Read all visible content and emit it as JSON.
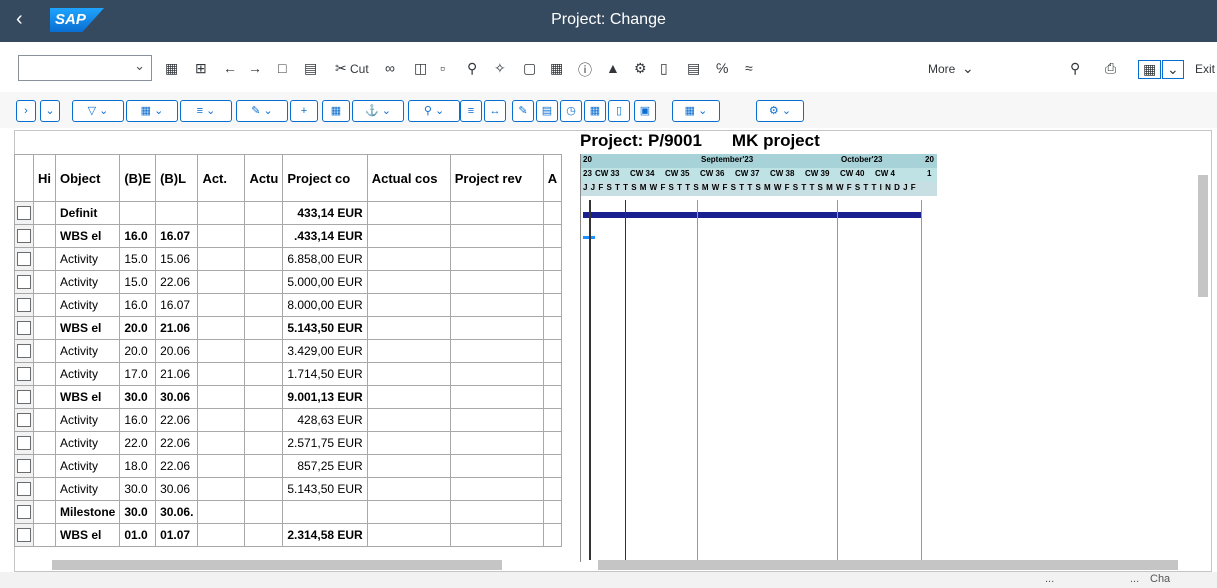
{
  "window": {
    "title": "Project: Change",
    "logo_text": "SAP"
  },
  "toolbar": {
    "icons": [
      "tree-icon",
      "grid-icon",
      "back-arrow-icon",
      "forward-arrow-icon",
      "copy-icon",
      "paste-icon",
      "scissors-icon",
      "link-icon",
      "save-icon",
      "delete-icon",
      "zoom-icon",
      "wand-icon",
      "frame-icon",
      "calculator-icon",
      "info-icon",
      "hat-icon",
      "network-icon",
      "chart-icon",
      "doc-icon",
      "percent-icon",
      "linechart-icon"
    ],
    "cut_label": "Cut",
    "more_label": "More",
    "exit_label": "Exit"
  },
  "gantt": {
    "project_label": "Project: P/9001",
    "project_name": "MK project",
    "months": [
      "20",
      "September'23",
      "October'23",
      "20"
    ],
    "weeks": [
      "23",
      "CW 33",
      "CW 34",
      "CW 35",
      "CW 36",
      "CW 37",
      "CW 38",
      "CW 39",
      "CW 40",
      "CW 4",
      "1"
    ],
    "days_text": "J J F S T T S M W F S T T S M W F S T T S M W F S T T S M W F S T T I N D J F"
  },
  "table": {
    "headers": [
      "Hi",
      "Object",
      "(B)E",
      "(B)L",
      "Act.",
      "Actu",
      "Project co",
      "Actual cos",
      "Project rev",
      "A"
    ],
    "rows": [
      {
        "object": "Definit",
        "be": "",
        "bl": "",
        "cost": "433,14 EUR",
        "bold": true
      },
      {
        "object": "WBS el",
        "be": "16.0",
        "bl": "16.07",
        "cost": ".433,14 EUR",
        "bold": true
      },
      {
        "object": "Activity",
        "be": "15.0",
        "bl": "15.06",
        "cost": "6.858,00 EUR",
        "bold": false
      },
      {
        "object": "Activity",
        "be": "15.0",
        "bl": "22.06",
        "cost": "5.000,00 EUR",
        "bold": false
      },
      {
        "object": "Activity",
        "be": "16.0",
        "bl": "16.07",
        "cost": "8.000,00 EUR",
        "bold": false
      },
      {
        "object": "WBS el",
        "be": "20.0",
        "bl": "21.06",
        "cost": "5.143,50 EUR",
        "bold": true
      },
      {
        "object": "Activity",
        "be": "20.0",
        "bl": "20.06",
        "cost": "3.429,00 EUR",
        "bold": false
      },
      {
        "object": "Activity",
        "be": "17.0",
        "bl": "21.06",
        "cost": "1.714,50 EUR",
        "bold": false
      },
      {
        "object": "WBS el",
        "be": "30.0",
        "bl": "30.06",
        "cost": "9.001,13 EUR",
        "bold": true
      },
      {
        "object": "Activity",
        "be": "16.0",
        "bl": "22.06",
        "cost": "428,63 EUR",
        "bold": false
      },
      {
        "object": "Activity",
        "be": "22.0",
        "bl": "22.06",
        "cost": "2.571,75 EUR",
        "bold": false
      },
      {
        "object": "Activity",
        "be": "18.0",
        "bl": "22.06",
        "cost": "857,25 EUR",
        "bold": false
      },
      {
        "object": "Activity",
        "be": "30.0",
        "bl": "30.06",
        "cost": "5.143,50 EUR",
        "bold": false
      },
      {
        "object": "Milestone",
        "be": "30.0",
        "bl": "30.06.",
        "cost": "",
        "bold": true
      },
      {
        "object": "WBS el",
        "be": "01.0",
        "bl": "01.07",
        "cost": "2.314,58 EUR",
        "bold": true
      }
    ]
  },
  "status": {
    "dots1": "...",
    "dots2": "...",
    "text": "Cha"
  }
}
